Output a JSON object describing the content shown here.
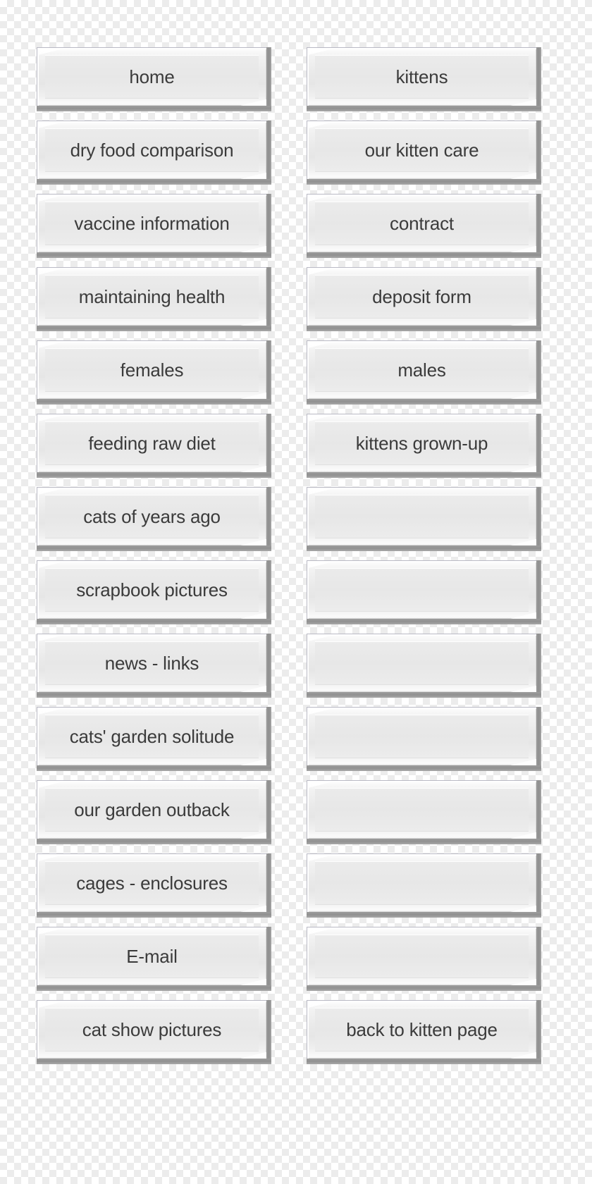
{
  "page": {
    "title": "site navigation buttons",
    "background_style": "checkerboard-transparency",
    "colors": {
      "button_face": "#e8e8e8",
      "button_highlight": "#ffffff",
      "button_shadow": "#919191",
      "button_border": "#b9b9c4",
      "label_text": "#3b3b3b",
      "checker_light": "#ffffff",
      "checker_dark": "#ececec"
    }
  },
  "nav": {
    "columns": [
      {
        "name": "left-column",
        "buttons": [
          {
            "label": "home",
            "blank": false
          },
          {
            "label": "dry food comparison",
            "blank": false
          },
          {
            "label": "vaccine information",
            "blank": false
          },
          {
            "label": "maintaining health",
            "blank": false
          },
          {
            "label": "females",
            "blank": false
          },
          {
            "label": "feeding raw diet",
            "blank": false
          },
          {
            "label": "cats of years ago",
            "blank": false
          },
          {
            "label": "scrapbook pictures",
            "blank": false
          },
          {
            "label": "news - links",
            "blank": false
          },
          {
            "label": "cats' garden solitude",
            "blank": false
          },
          {
            "label": "our garden outback",
            "blank": false
          },
          {
            "label": "cages - enclosures",
            "blank": false
          },
          {
            "label": "E-mail",
            "blank": false
          },
          {
            "label": "cat show pictures",
            "blank": false
          }
        ]
      },
      {
        "name": "right-column",
        "buttons": [
          {
            "label": "kittens",
            "blank": false
          },
          {
            "label": "our kitten care",
            "blank": false
          },
          {
            "label": "contract",
            "blank": false
          },
          {
            "label": "deposit form",
            "blank": false
          },
          {
            "label": "males",
            "blank": false
          },
          {
            "label": "kittens grown-up",
            "blank": false
          },
          {
            "label": "",
            "blank": true
          },
          {
            "label": "",
            "blank": true
          },
          {
            "label": "",
            "blank": true
          },
          {
            "label": "",
            "blank": true
          },
          {
            "label": "",
            "blank": true
          },
          {
            "label": "",
            "blank": true
          },
          {
            "label": "",
            "blank": true
          },
          {
            "label": "back to kitten page",
            "blank": false
          }
        ]
      }
    ]
  }
}
